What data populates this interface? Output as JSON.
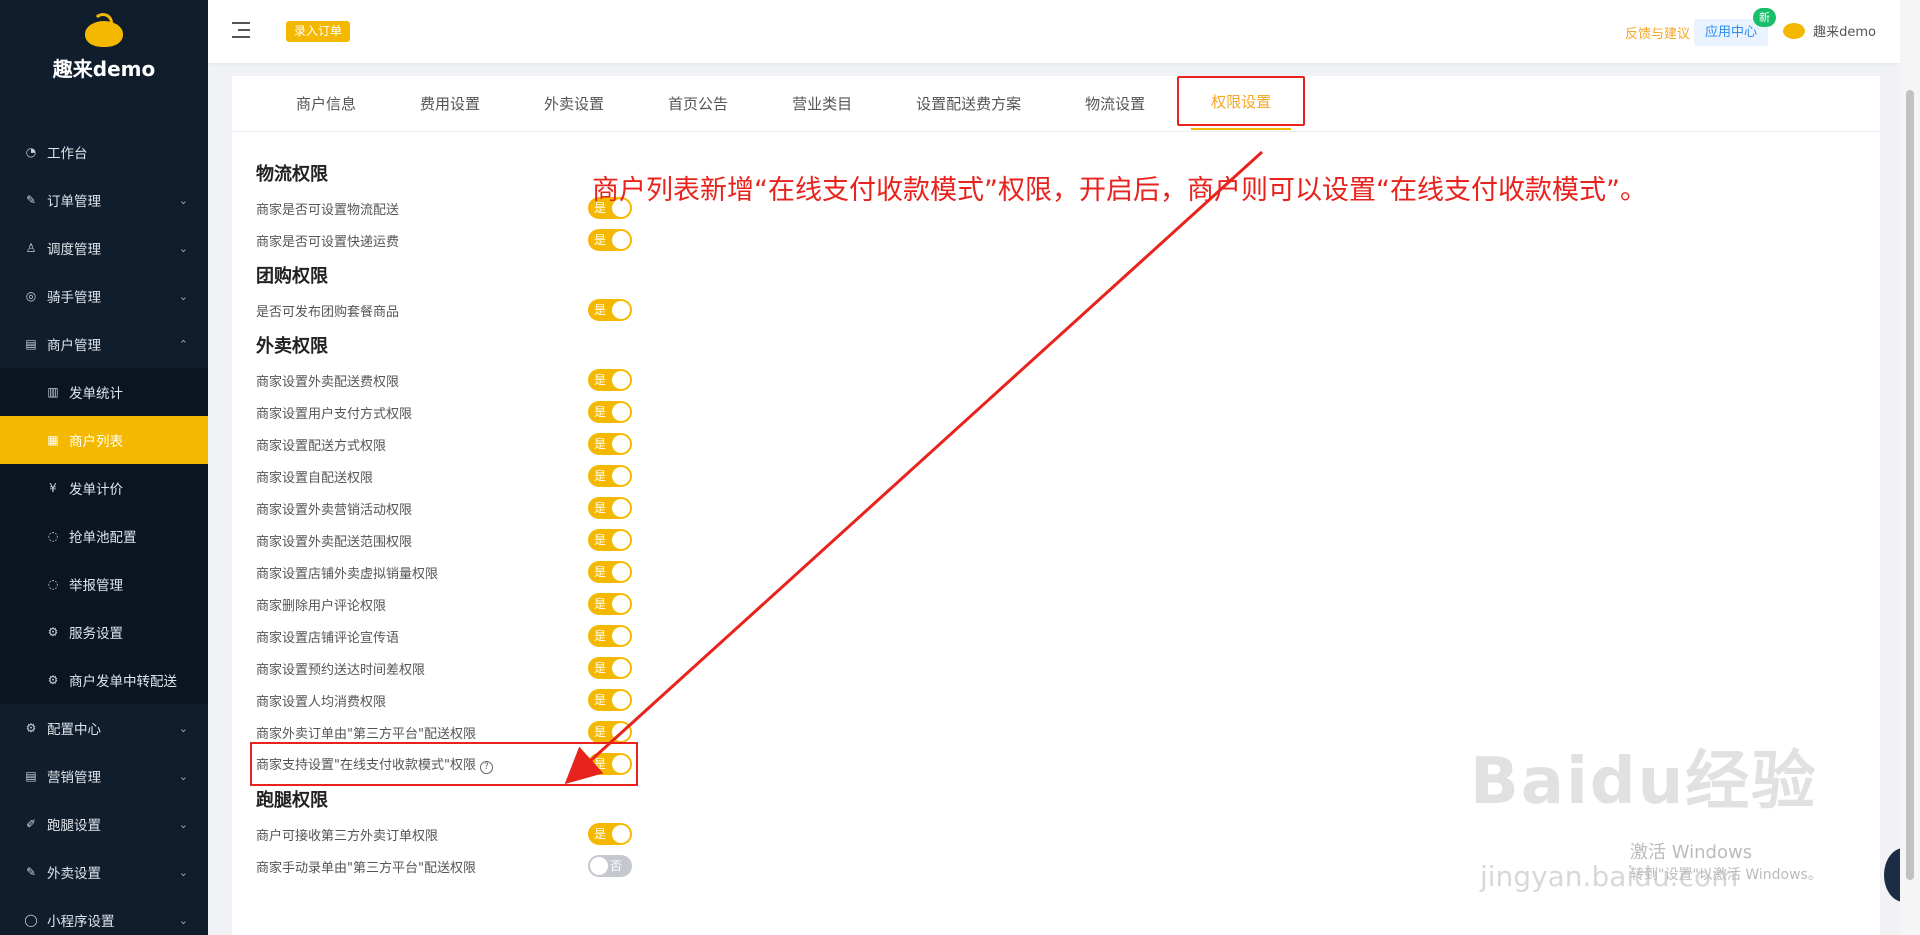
{
  "sidebar": {
    "brand": "趣来demo",
    "items": [
      {
        "label": "工作台",
        "icon": "dashboard-icon",
        "expand": false
      },
      {
        "label": "订单管理",
        "icon": "order-icon",
        "expand": true
      },
      {
        "label": "调度管理",
        "icon": "user-icon",
        "expand": true
      },
      {
        "label": "骑手管理",
        "icon": "rider-icon",
        "expand": true
      },
      {
        "label": "商户管理",
        "icon": "shop-icon",
        "expand": true,
        "open": true
      },
      {
        "label": "发单统计",
        "icon": "chart-icon",
        "sub": true
      },
      {
        "label": "商户列表",
        "icon": "list-icon",
        "sub": true,
        "active": true
      },
      {
        "label": "发单计价",
        "icon": "price-icon",
        "sub": true
      },
      {
        "label": "抢单池配置",
        "icon": "pool-icon",
        "sub": true
      },
      {
        "label": "举报管理",
        "icon": "report-icon",
        "sub": true
      },
      {
        "label": "服务设置",
        "icon": "gear-icon",
        "sub": true
      },
      {
        "label": "商户发单中转配送",
        "icon": "gear-icon",
        "sub": true
      },
      {
        "label": "配置中心",
        "icon": "config-icon",
        "expand": true
      },
      {
        "label": "营销管理",
        "icon": "marketing-icon",
        "expand": true
      },
      {
        "label": "跑腿设置",
        "icon": "errand-icon",
        "expand": true
      },
      {
        "label": "外卖设置",
        "icon": "delivery-icon",
        "expand": true
      },
      {
        "label": "小程序设置",
        "icon": "miniapp-icon",
        "expand": true
      }
    ]
  },
  "topbar": {
    "enter_order": "录入订单",
    "feedback": "反馈与建议",
    "app_center": "应用中心",
    "new_badge": "新",
    "user": "趣来demo"
  },
  "tabs": [
    "商户信息",
    "费用设置",
    "外卖设置",
    "首页公告",
    "营业类目",
    "设置配送费方案",
    "物流设置",
    "权限设置"
  ],
  "active_tab": "权限设置",
  "sections": [
    {
      "title": "物流权限",
      "rows": [
        {
          "label": "商家是否可设置物流配送",
          "value": "是",
          "on": true
        },
        {
          "label": "商家是否可设置快递运费",
          "value": "是",
          "on": true
        }
      ]
    },
    {
      "title": "团购权限",
      "rows": [
        {
          "label": "是否可发布团购套餐商品",
          "value": "是",
          "on": true
        }
      ]
    },
    {
      "title": "外卖权限",
      "rows": [
        {
          "label": "商家设置外卖配送费权限",
          "value": "是",
          "on": true
        },
        {
          "label": "商家设置用户支付方式权限",
          "value": "是",
          "on": true
        },
        {
          "label": "商家设置配送方式权限",
          "value": "是",
          "on": true
        },
        {
          "label": "商家设置自配送权限",
          "value": "是",
          "on": true
        },
        {
          "label": "商家设置外卖营销活动权限",
          "value": "是",
          "on": true
        },
        {
          "label": "商家设置外卖配送范围权限",
          "value": "是",
          "on": true
        },
        {
          "label": "商家设置店铺外卖虚拟销量权限",
          "value": "是",
          "on": true
        },
        {
          "label": "商家删除用户评论权限",
          "value": "是",
          "on": true
        },
        {
          "label": "商家设置店铺评论宣传语",
          "value": "是",
          "on": true
        },
        {
          "label": "商家设置预约送达时间差权限",
          "value": "是",
          "on": true
        },
        {
          "label": "商家设置人均消费权限",
          "value": "是",
          "on": true
        },
        {
          "label": "商家外卖订单由\"第三方平台\"配送权限",
          "value": "是",
          "on": true
        },
        {
          "label": "商家支持设置\"在线支付收款模式\"权限",
          "value": "是",
          "on": true,
          "highlight": true,
          "help": true
        }
      ]
    },
    {
      "title": "跑腿权限",
      "rows": [
        {
          "label": "商户可接收第三方外卖订单权限",
          "value": "是",
          "on": true
        },
        {
          "label": "商家手动录单由\"第三方平台\"配送权限",
          "value": "否",
          "on": false
        }
      ]
    }
  ],
  "annotation": "商户列表新增“在线支付收款模式”权限，开启后，商户则可以设置“在线支付收款模式”。",
  "watermark": {
    "logo": "Baidu经验",
    "url": "jingyan.baidu.com"
  },
  "windows_notice": {
    "line1": "激活 Windows",
    "line2": "转到\"设置\"以激活 Windows。"
  },
  "colors": {
    "accent": "#f5b800",
    "annotation": "#e8231d",
    "sidebar": "#101d2d"
  }
}
